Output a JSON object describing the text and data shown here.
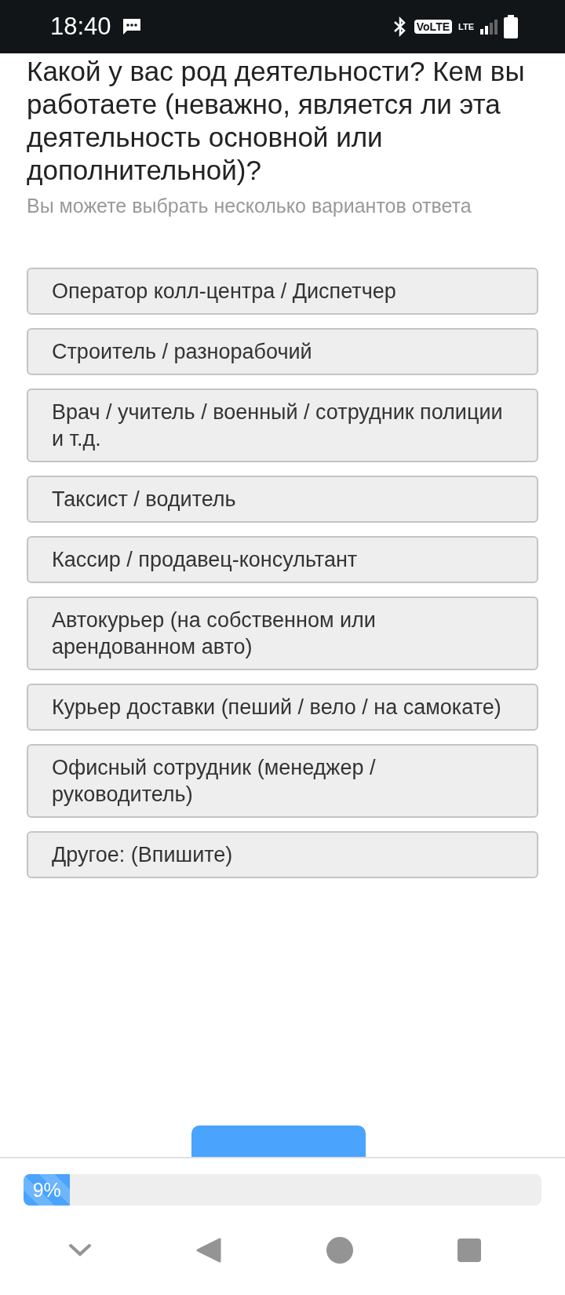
{
  "status_bar": {
    "time": "18:40",
    "volte": "VoLTE",
    "network": "LTE"
  },
  "question": {
    "title": "Какой у вас род деятельности? Кем вы работаете (неважно, является ли эта деятельность основной или дополнительной)?",
    "hint": "Вы можете выбрать несколько вариантов ответа"
  },
  "options": [
    {
      "label": "Оператор колл-центра / Диспетчер",
      "selected": false
    },
    {
      "label": "Строитель / разнорабочий",
      "selected": false
    },
    {
      "label": "Врач / учитель / военный / сотрудник полиции и т.д.",
      "selected": false
    },
    {
      "label": "Таксист / водитель",
      "selected": false
    },
    {
      "label": "Кассир / продавец-консультант",
      "selected": false
    },
    {
      "label": "Автокурьер (на собственном или арендованном авто)",
      "selected": false
    },
    {
      "label": "Курьер доставки (пеший / вело / на самокате)",
      "selected": false
    },
    {
      "label": "Офисный сотрудник (менеджер / руководитель)",
      "selected": false
    },
    {
      "label": "Другое: (Впишите)",
      "selected": false
    }
  ],
  "progress": {
    "label": "9%",
    "level": 0.09
  }
}
